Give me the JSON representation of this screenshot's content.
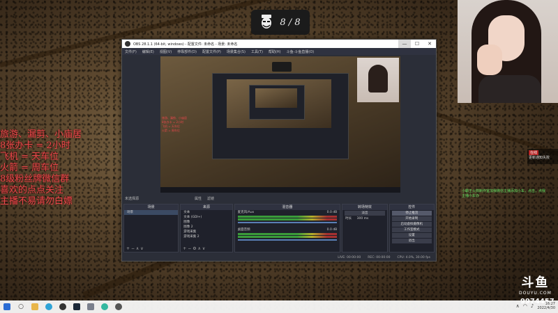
{
  "badge": {
    "counter": "8 / 8"
  },
  "overlay_text": [
    "旅游、漏剪、小庙居",
    "8张办卡 = 2小时",
    "飞机 =    天车位",
    "火箭 =    周车位",
    "8级粉丝牌微信群",
    "喜欢的点点关注",
    "主播不易请勿白嫖"
  ],
  "right_panel": {
    "highlight": "在线",
    "note": "更新通知失败"
  },
  "green_note": "小霸王火箭制作室加我微信主播添加小车，点击，点我主播小车办",
  "douyu": {
    "mark": "斗鱼",
    "sub": "DOUYU.COM",
    "room_id": "9974457"
  },
  "obs": {
    "title": "OBS 28.1.1 (64-bit, windows) - 配置文件: 未命名 - 场景: 未命名",
    "menu": [
      "文件(F)",
      "编辑(E)",
      "视图(V)",
      "停靠部件(D)",
      "配置文件(P)",
      "场景集合(S)",
      "工具(T)",
      "帮助(H)",
      "斗鱼-斗鱼直播(O)"
    ],
    "window_buttons": {
      "minimize": "—",
      "maximize": "☐",
      "close": "✕"
    },
    "source_toolbar": {
      "label": "未选择源",
      "properties": "属性",
      "filters": "滤镜"
    },
    "docks": {
      "scenes": {
        "header": "场景",
        "items": [
          "场景"
        ]
      },
      "sources": {
        "header": "来源",
        "items": [
          "文本",
          "文本 (GDI+)",
          "图像",
          "图像 2",
          "游戏采集",
          "游戏采集 2"
        ]
      },
      "mixer": {
        "header": "混音器",
        "channels": [
          {
            "name": "麦克风/Aux",
            "level": "0.0 dB"
          },
          {
            "name": "桌面音频",
            "level": "0.0 dB"
          }
        ]
      },
      "transitions": {
        "header": "转场特效",
        "mode": "淡出",
        "duration_label": "时长",
        "duration": "300 ms"
      },
      "controls": {
        "header": "控件",
        "buttons": [
          "停止推流",
          "开始录制",
          "启动虚拟摄像机",
          "工作室模式",
          "设置",
          "退出"
        ]
      }
    },
    "status": {
      "live": "LIVE: 00:00:00",
      "rec": "REC: 00:00:00",
      "cpu": "CPU: 4.0%, 30.00 fps"
    }
  },
  "taskbar": {
    "icons": [
      "windows-start",
      "search",
      "file-explorer",
      "edge",
      "obs",
      "steam",
      "app",
      "edge-2",
      "obs-2"
    ],
    "time": "16:27",
    "date": "2022/4/30"
  }
}
